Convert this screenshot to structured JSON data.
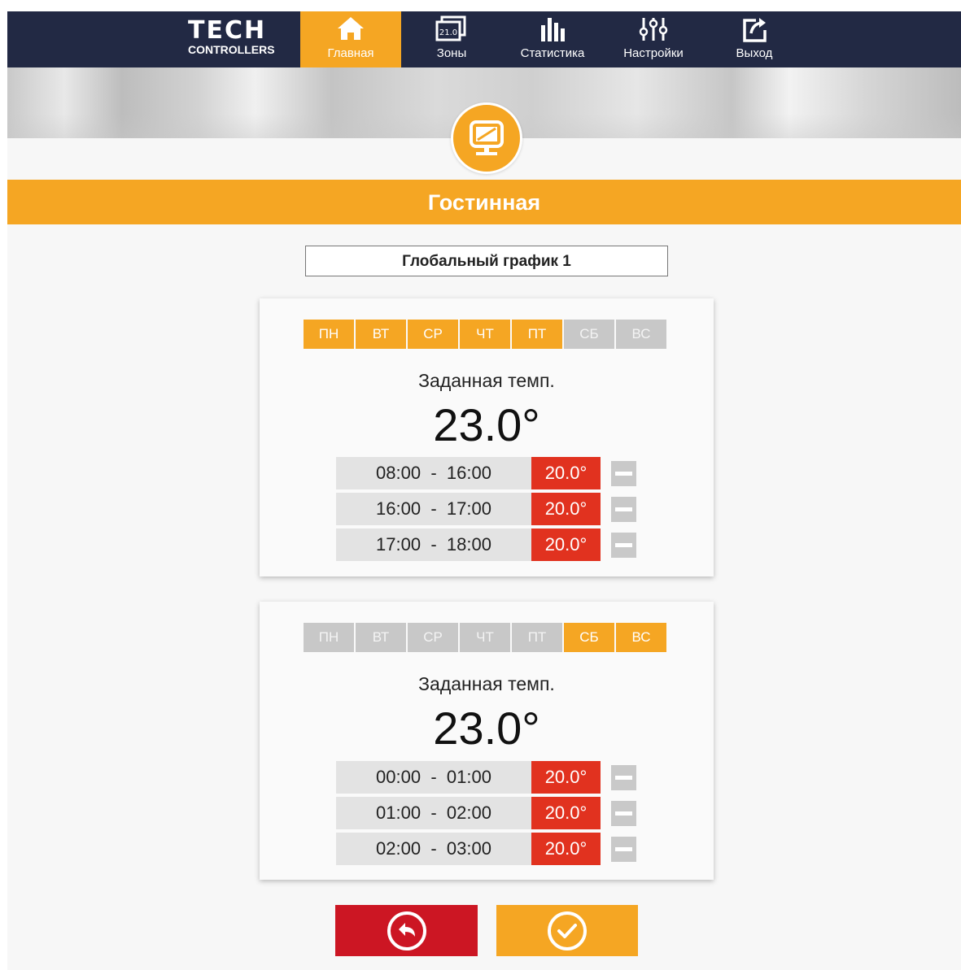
{
  "brand": {
    "name": "TECH",
    "subtitle": "CONTROLLERS"
  },
  "nav": {
    "items": [
      {
        "label": "Главная",
        "icon": "home-icon",
        "active": true
      },
      {
        "label": "Зоны",
        "icon": "zones-icon",
        "active": false,
        "icon_text": "21.0"
      },
      {
        "label": "Статистика",
        "icon": "statistics-icon",
        "active": false
      },
      {
        "label": "Настройки",
        "icon": "settings-sliders-icon",
        "active": false
      },
      {
        "label": "Выход",
        "icon": "logout-icon",
        "active": false
      }
    ]
  },
  "room": {
    "title": "Гостинная",
    "icon": "monitor-icon"
  },
  "schedule": {
    "selected": "Глобальный график 1"
  },
  "cards": [
    {
      "days": [
        {
          "label": "ПН",
          "active": true
        },
        {
          "label": "ВТ",
          "active": true
        },
        {
          "label": "СР",
          "active": true
        },
        {
          "label": "ЧТ",
          "active": true
        },
        {
          "label": "ПТ",
          "active": true
        },
        {
          "label": "СБ",
          "active": false
        },
        {
          "label": "ВС",
          "active": false
        }
      ],
      "set_label": "Заданная темп.",
      "set_temp": "23.0°",
      "intervals": [
        {
          "time": "08:00  -  16:00",
          "temp": "20.0°"
        },
        {
          "time": "16:00  -  17:00",
          "temp": "20.0°"
        },
        {
          "time": "17:00  -  18:00",
          "temp": "20.0°"
        }
      ]
    },
    {
      "days": [
        {
          "label": "ПН",
          "active": false
        },
        {
          "label": "ВТ",
          "active": false
        },
        {
          "label": "СР",
          "active": false
        },
        {
          "label": "ЧТ",
          "active": false
        },
        {
          "label": "ПТ",
          "active": false
        },
        {
          "label": "СБ",
          "active": true
        },
        {
          "label": "ВС",
          "active": true
        }
      ],
      "set_label": "Заданная темп.",
      "set_temp": "23.0°",
      "intervals": [
        {
          "time": "00:00  -  01:00",
          "temp": "20.0°"
        },
        {
          "time": "01:00  -  02:00",
          "temp": "20.0°"
        },
        {
          "time": "02:00  -  03:00",
          "temp": "20.0°"
        }
      ]
    }
  ],
  "actions": {
    "back_icon": "back-arrow-icon",
    "confirm_icon": "checkmark-icon"
  },
  "colors": {
    "nav_bg": "#222944",
    "accent": "#f5a623",
    "temp_red": "#e1321f",
    "back_red": "#cc1623",
    "inactive_day": "#c8c8c8"
  }
}
